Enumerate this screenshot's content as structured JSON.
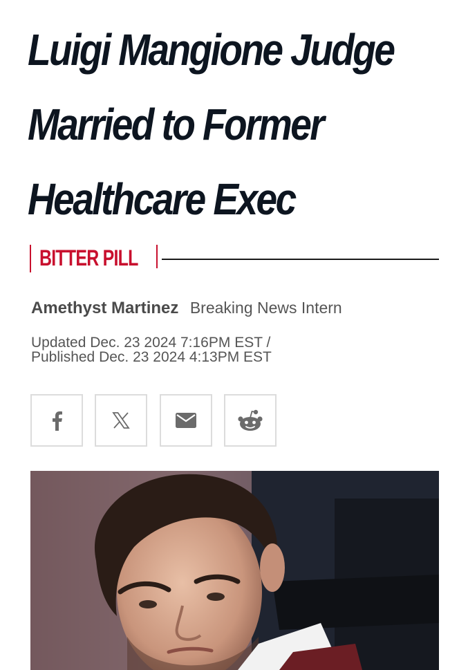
{
  "article": {
    "headline_line1": "Luigi Mangione Judge",
    "headline_line2": "Married to Former",
    "headline_line3": "Healthcare Exec",
    "kicker": "BITTER PILL",
    "author": "Amethyst Martinez",
    "author_role": "Breaking News Intern",
    "updated": "Updated Dec. 23 2024 7:16PM EST /",
    "published": "Published Dec. 23 2024 4:13PM EST"
  },
  "share": {
    "buttons": [
      {
        "icon": "facebook-icon"
      },
      {
        "icon": "x-icon"
      },
      {
        "icon": "email-icon"
      },
      {
        "icon": "reddit-icon"
      }
    ]
  },
  "colors": {
    "kicker_red": "#c8102e",
    "headline": "#0d1520",
    "meta_gray": "#555555",
    "share_icon": "#6b6b6b",
    "share_border": "#dcdcdc"
  }
}
